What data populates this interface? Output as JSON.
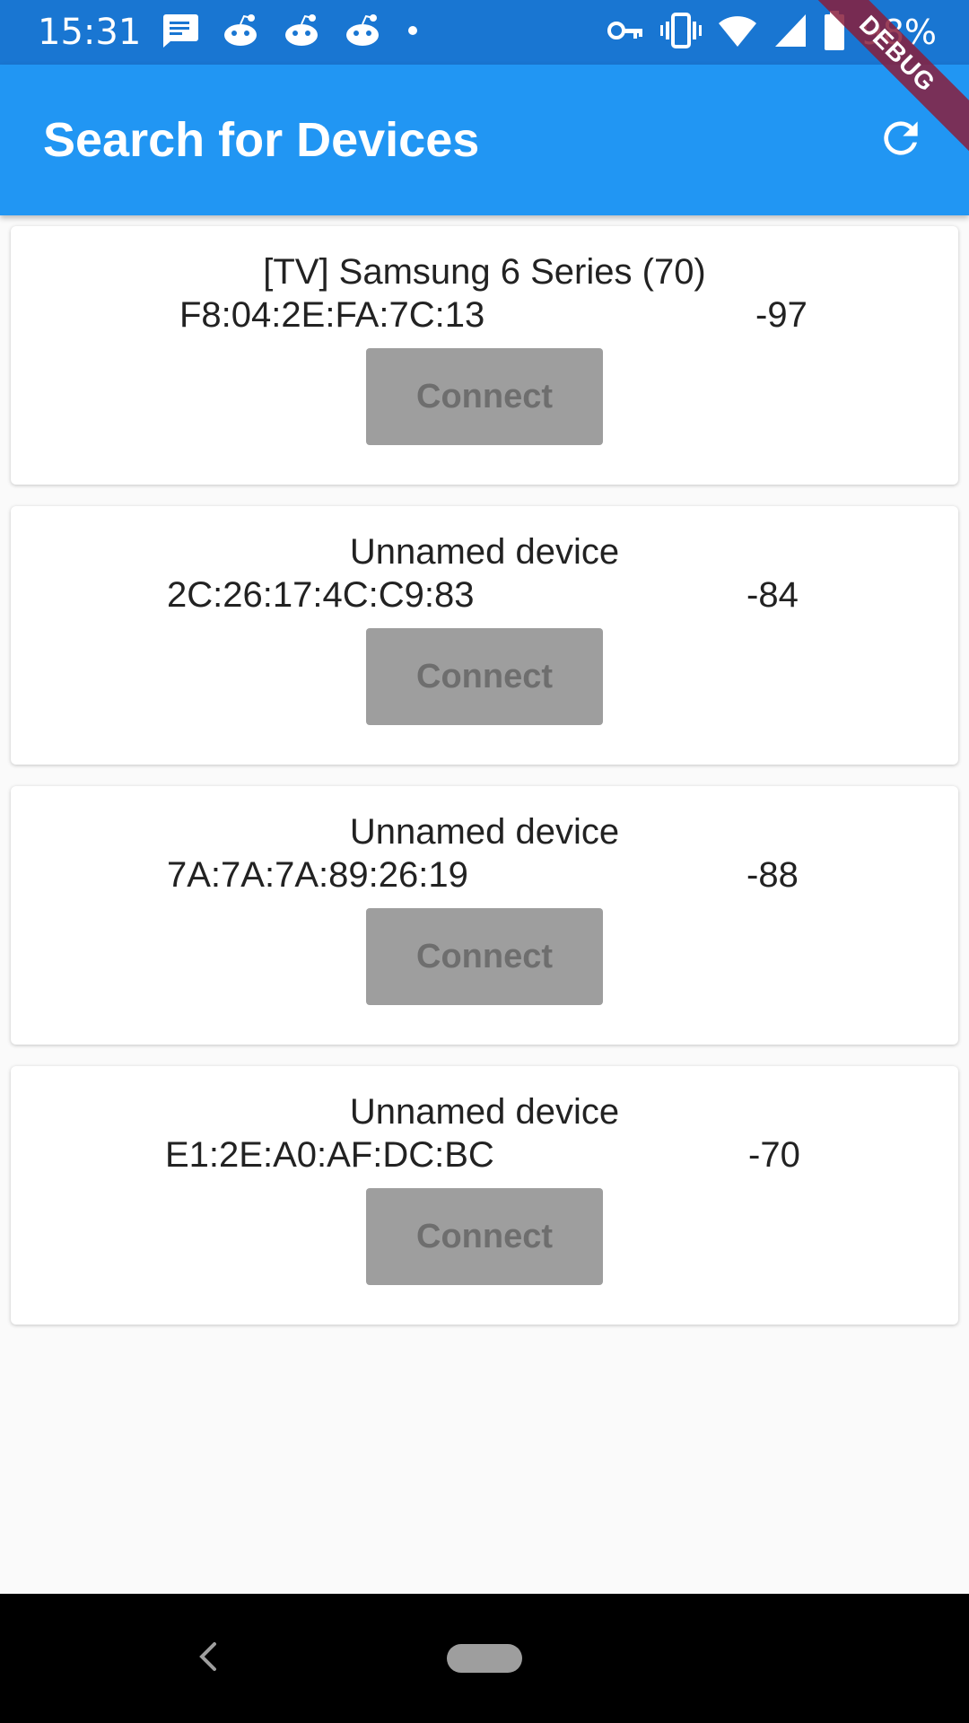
{
  "status_bar": {
    "time": "15:31",
    "battery": "98%",
    "left_icons": [
      "message-icon",
      "reddit-icon",
      "reddit-icon",
      "reddit-icon",
      "dot-icon"
    ],
    "right_icons": [
      "vpn-key-icon",
      "vibrate-icon",
      "wifi-icon",
      "signal-icon",
      "battery-icon"
    ]
  },
  "debug_banner": "DEBUG",
  "app_bar": {
    "title": "Search for Devices",
    "action_icon": "refresh-icon"
  },
  "devices": [
    {
      "name": "[TV] Samsung 6 Series (70)",
      "mac": "F8:04:2E:FA:7C:13",
      "rssi": "-97",
      "button_label": "Connect"
    },
    {
      "name": "Unnamed device",
      "mac": "2C:26:17:4C:C9:83",
      "rssi": "-84",
      "button_label": "Connect"
    },
    {
      "name": "Unnamed device",
      "mac": "7A:7A:7A:89:26:19",
      "rssi": "-88",
      "button_label": "Connect"
    },
    {
      "name": "Unnamed device",
      "mac": "E1:2E:A0:AF:DC:BC",
      "rssi": "-70",
      "button_label": "Connect"
    }
  ],
  "nav_bar": {
    "icons": [
      "back-icon",
      "home-pill-icon"
    ]
  },
  "colors": {
    "status_bar": "#1976d2",
    "app_bar": "#2196f3",
    "button_disabled": "#9e9e9e",
    "background": "#fafafa"
  }
}
